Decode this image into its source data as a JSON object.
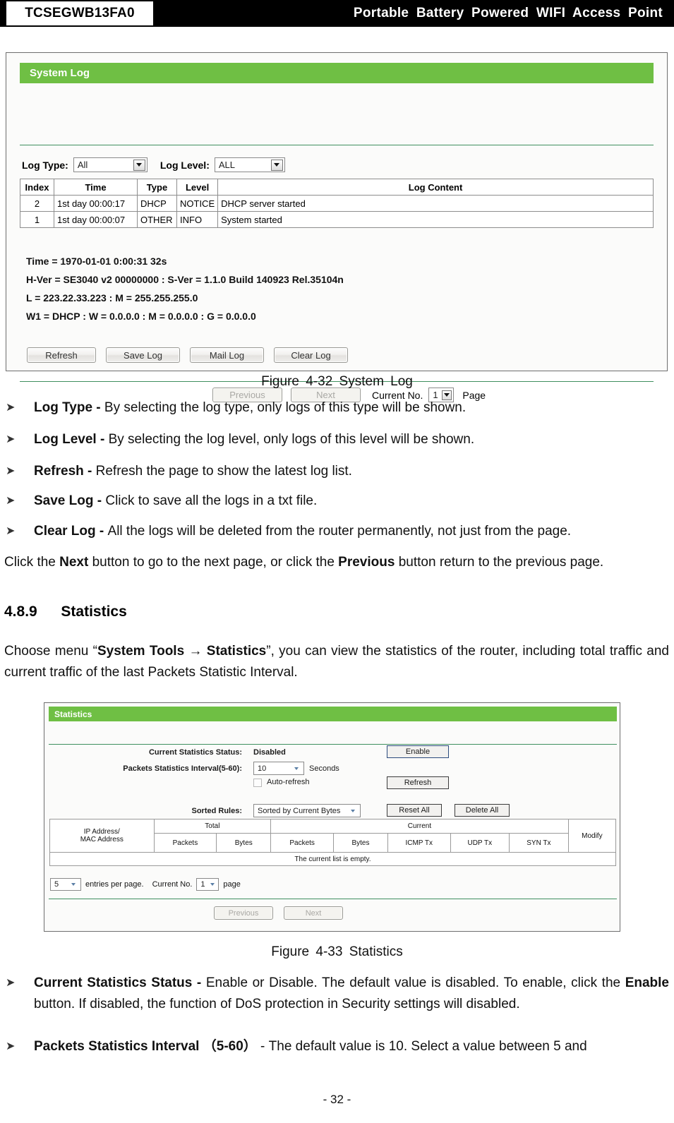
{
  "running_head": {
    "model": "TCSEGWB13FA0",
    "title": "Portable  Battery  Powered  WIFI  Access  Point"
  },
  "figure_system_log": {
    "panel_title": "System Log",
    "filters": {
      "log_type_label": "Log Type:",
      "log_type_value": "All",
      "log_level_label": "Log Level:",
      "log_level_value": "ALL"
    },
    "table": {
      "headers": [
        "Index",
        "Time",
        "Type",
        "Level",
        "Log Content"
      ],
      "rows": [
        [
          "2",
          "1st day 00:00:17",
          "DHCP",
          "NOTICE",
          "DHCP server started"
        ],
        [
          "1",
          "1st day 00:00:07",
          "OTHER",
          "INFO",
          "System started"
        ]
      ]
    },
    "info_lines": [
      "Time = 1970-01-01 0:00:31 32s",
      "H-Ver = SE3040 v2 00000000 : S-Ver = 1.1.0 Build 140923 Rel.35104n",
      "L = 223.22.33.223 : M = 255.255.255.0",
      "W1 = DHCP : W = 0.0.0.0 : M = 0.0.0.0 : G = 0.0.0.0"
    ],
    "buttons": [
      "Refresh",
      "Save Log",
      "Mail Log",
      "Clear Log"
    ],
    "pagination": {
      "previous": "Previous",
      "next": "Next",
      "current_label": "Current No.",
      "current_value": "1",
      "page_label": "Page"
    }
  },
  "caption_4_32": "Figure 4-32    System Log",
  "bullets_log": [
    {
      "term": "Log Type - ",
      "rest": "By selecting the log type, only logs of this type will be shown."
    },
    {
      "term": "Log Level - ",
      "rest": "By selecting the log level, only logs of this level will be shown."
    },
    {
      "term": "Refresh - ",
      "rest": "Refresh the page to show the latest log list."
    },
    {
      "term": "Save Log - ",
      "rest": "Click to save all the logs in a txt file."
    },
    {
      "term": "Clear Log - ",
      "rest": "All the logs will be deleted from the router permanently, not just from the page."
    }
  ],
  "para_next_prev": {
    "p1": "Click the ",
    "b1": "Next",
    "p2": " button to go to the next page, or click the ",
    "b2": "Previous",
    "p3": " button return to the previous page."
  },
  "section": {
    "number": "4.8.9",
    "title": "Statistics"
  },
  "para_statistics": {
    "p1": "Choose menu “",
    "b1": "System Tools  →  Statistics",
    "p2": "”, you can view the statistics of the router, including total traffic and current traffic of the last Packets Statistic Interval."
  },
  "figure_statistics": {
    "panel_title": "Statistics",
    "current_status_label": "Current Statistics Status:",
    "current_status_value": "Disabled",
    "enable_button": "Enable",
    "interval_label": "Packets Statistics Interval(5-60):",
    "interval_value": "10",
    "interval_units": "Seconds",
    "auto_refresh_label": "Auto-refresh",
    "refresh_button": "Refresh",
    "sorted_rules_label": "Sorted Rules:",
    "sorted_rules_value": "Sorted by Current Bytes",
    "reset_all_button": "Reset All",
    "delete_all_button": "Delete All",
    "table": {
      "group_headers": [
        "",
        "Total",
        "Current",
        "Modify"
      ],
      "sub_headers": [
        "IP Address/",
        "MAC Address",
        "Packets",
        "Bytes",
        "Packets",
        "Bytes",
        "ICMP Tx",
        "UDP Tx",
        "SYN Tx"
      ],
      "empty_message": "The current list is empty."
    },
    "entries_value": "5",
    "entries_label": "entries per page.",
    "current_no_label": "Current No.",
    "current_no_value": "1",
    "page_label": "page",
    "previous": "Previous",
    "next": "Next"
  },
  "caption_4_33": "Figure 4-33    Statistics",
  "bullets_stats": [
    {
      "term": "Current Statistics Status - ",
      "rest_a": "Enable or Disable. The default value is disabled. To enable, click the ",
      "bold_mid": "Enable",
      "rest_b": " button. If disabled, the function of DoS protection in Security settings will disabled."
    },
    {
      "term": "Packets Statistics Interval ",
      "term2": "（5-60）",
      "rest_a": "  - The default value is 10. Select a value between 5 and"
    }
  ],
  "page_number": "- 32 -",
  "colors": {
    "panel_green": "#6fbf44",
    "rule_green": "#3f8f5f",
    "header_black": "#000000"
  }
}
